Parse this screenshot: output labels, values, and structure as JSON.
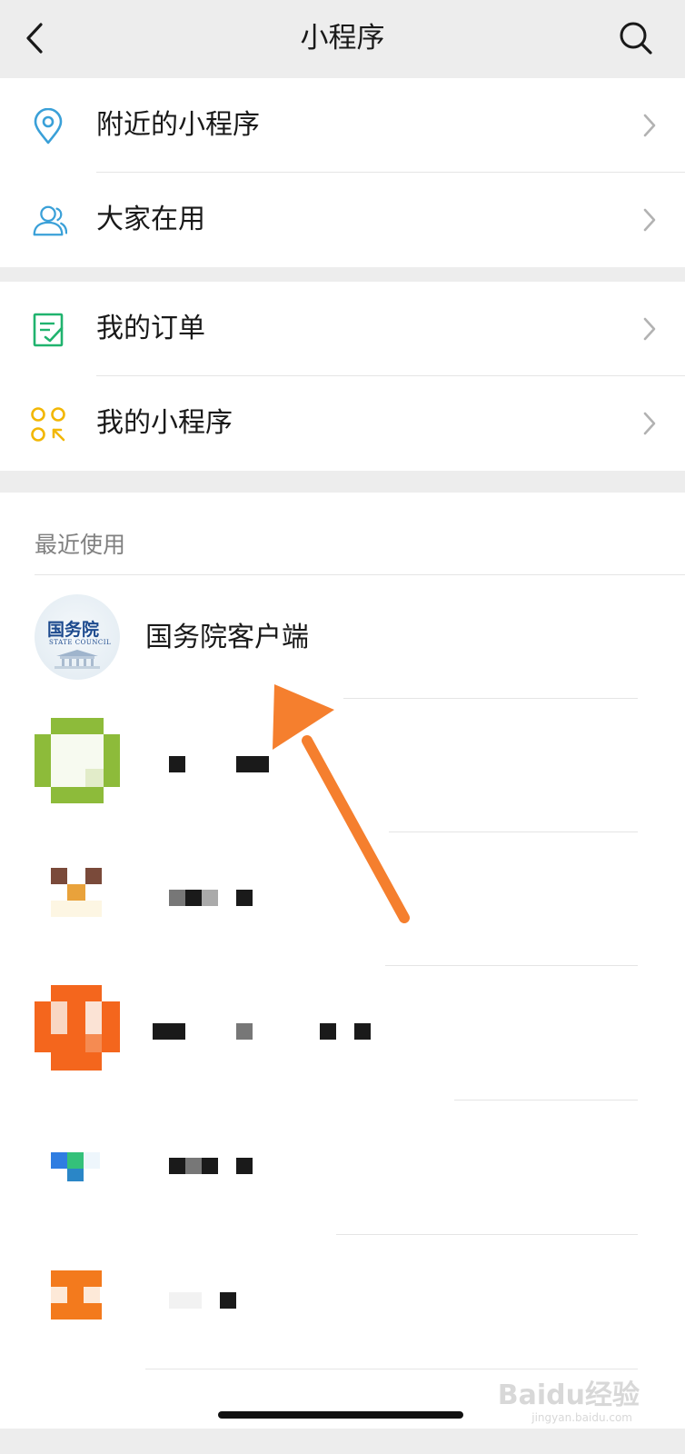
{
  "nav": {
    "title": "小程序",
    "back_icon": "chevron-left-icon",
    "search_icon": "search-icon"
  },
  "menu_groups": [
    {
      "items": [
        {
          "label": "附近的小程序",
          "icon": "location-pin-icon",
          "icon_color": "#3aa0d8"
        },
        {
          "label": "大家在用",
          "icon": "users-icon",
          "icon_color": "#3aa0d8"
        }
      ]
    },
    {
      "items": [
        {
          "label": "我的订单",
          "icon": "order-check-icon",
          "icon_color": "#20b36e"
        },
        {
          "label": "我的小程序",
          "icon": "grid-circles-icon",
          "icon_color": "#f2b705"
        }
      ]
    }
  ],
  "recent": {
    "title": "最近使用",
    "apps": [
      {
        "name": "国务院客户端",
        "logo_text": "国务院",
        "logo_sub": "STATE COUNCIL"
      },
      {
        "name": "",
        "obscured": true
      },
      {
        "name": "",
        "obscured": true
      },
      {
        "name": "",
        "obscured": true
      },
      {
        "name": "",
        "obscured": true
      },
      {
        "name": "",
        "obscured": true
      }
    ]
  },
  "colors": {
    "background": "#ededed",
    "card": "#ffffff",
    "annotation_arrow": "#f57f2e"
  },
  "watermark": {
    "text": "Baidu经验",
    "sub": "jingyan.baidu.com"
  }
}
